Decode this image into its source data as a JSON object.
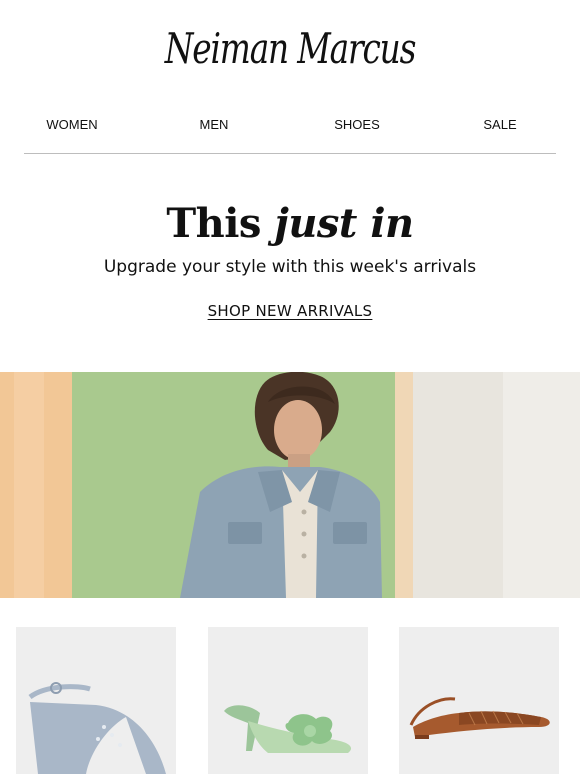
{
  "brand": {
    "logo_text": "Neiman Marcus"
  },
  "nav": {
    "items": [
      "WOMEN",
      "MEN",
      "SHOES",
      "SALE"
    ]
  },
  "promo": {
    "headline_plain": "This",
    "headline_italic": "just in",
    "subhead": "Upgrade your style with this week's arrivals",
    "cta_label": "SHOP NEW ARRIVALS"
  },
  "hero_image": {
    "subject": "model-in-denim-jacket"
  },
  "products": [
    {
      "subject": "light-blue-suede-block-heel-sandal"
    },
    {
      "subject": "green-floral-kitten-heel-mule"
    },
    {
      "subject": "woven-cognac-slingback-flat"
    }
  ],
  "colors": {
    "background": "#ffffff",
    "text": "#111111",
    "divider": "#bdbdbd",
    "hero_green_panel": "#a9c98e",
    "hero_peach": "#f3c99a",
    "denim": "#8ea3b4"
  }
}
